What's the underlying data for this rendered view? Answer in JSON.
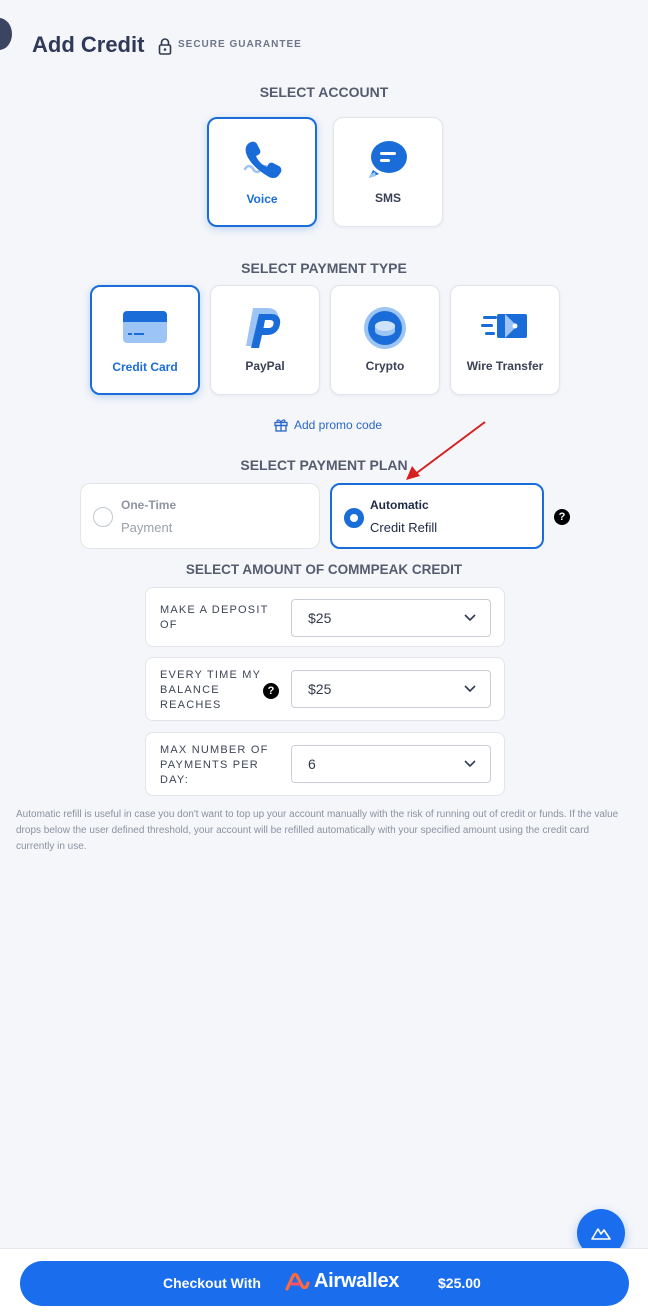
{
  "header": {
    "title": "Add Credit",
    "secure_label": "SECURE GUARANTEE"
  },
  "account": {
    "heading": "SELECT ACCOUNT",
    "items": [
      {
        "label": "Voice",
        "icon": "phone-icon",
        "selected": true
      },
      {
        "label": "SMS",
        "icon": "chat-bubble-icon",
        "selected": false
      }
    ]
  },
  "payment_type": {
    "heading": "SELECT PAYMENT TYPE",
    "items": [
      {
        "label": "Credit Card",
        "icon": "credit-card-icon",
        "selected": true
      },
      {
        "label": "PayPal",
        "icon": "paypal-icon",
        "selected": false
      },
      {
        "label": "Crypto",
        "icon": "coin-icon",
        "selected": false
      },
      {
        "label": "Wire Transfer",
        "icon": "wire-transfer-icon",
        "selected": false
      }
    ]
  },
  "promo": {
    "label": "Add promo code",
    "icon": "gift-icon"
  },
  "payment_plan": {
    "heading": "SELECT PAYMENT PLAN",
    "options": [
      {
        "title": "One-Time",
        "subtitle": "Payment",
        "selected": false
      },
      {
        "title": "Automatic",
        "subtitle": "Credit Refill",
        "selected": true
      }
    ],
    "help": "?"
  },
  "amount": {
    "heading": "SELECT AMOUNT OF COMMPEAK CREDIT",
    "rows": [
      {
        "label_line1": "MAKE A DEPOSIT",
        "label_line2": "OF",
        "label_line3": "",
        "value": "$25"
      },
      {
        "label_line1": "EVERY TIME MY",
        "label_line2": "BALANCE",
        "label_line3": "REACHES",
        "value": "$25",
        "help": "?"
      },
      {
        "label_line1": "MAX NUMBER OF",
        "label_line2": "PAYMENTS PER",
        "label_line3": "DAY:",
        "value": "6"
      }
    ]
  },
  "note": "Automatic refill is useful in case you don't want to top up your account manually with the risk of running out of credit or funds. If the value drops below the user defined threshold, your account will be refilled automatically with your specified amount using the credit card currently in use.",
  "checkout": {
    "prefix": "Checkout With",
    "brand": "Airwallex",
    "amount": "$25.00"
  },
  "colors": {
    "accent": "#1a6dec",
    "selected_border": "#1a6dd8",
    "annotation_arrow": "#d62020"
  }
}
